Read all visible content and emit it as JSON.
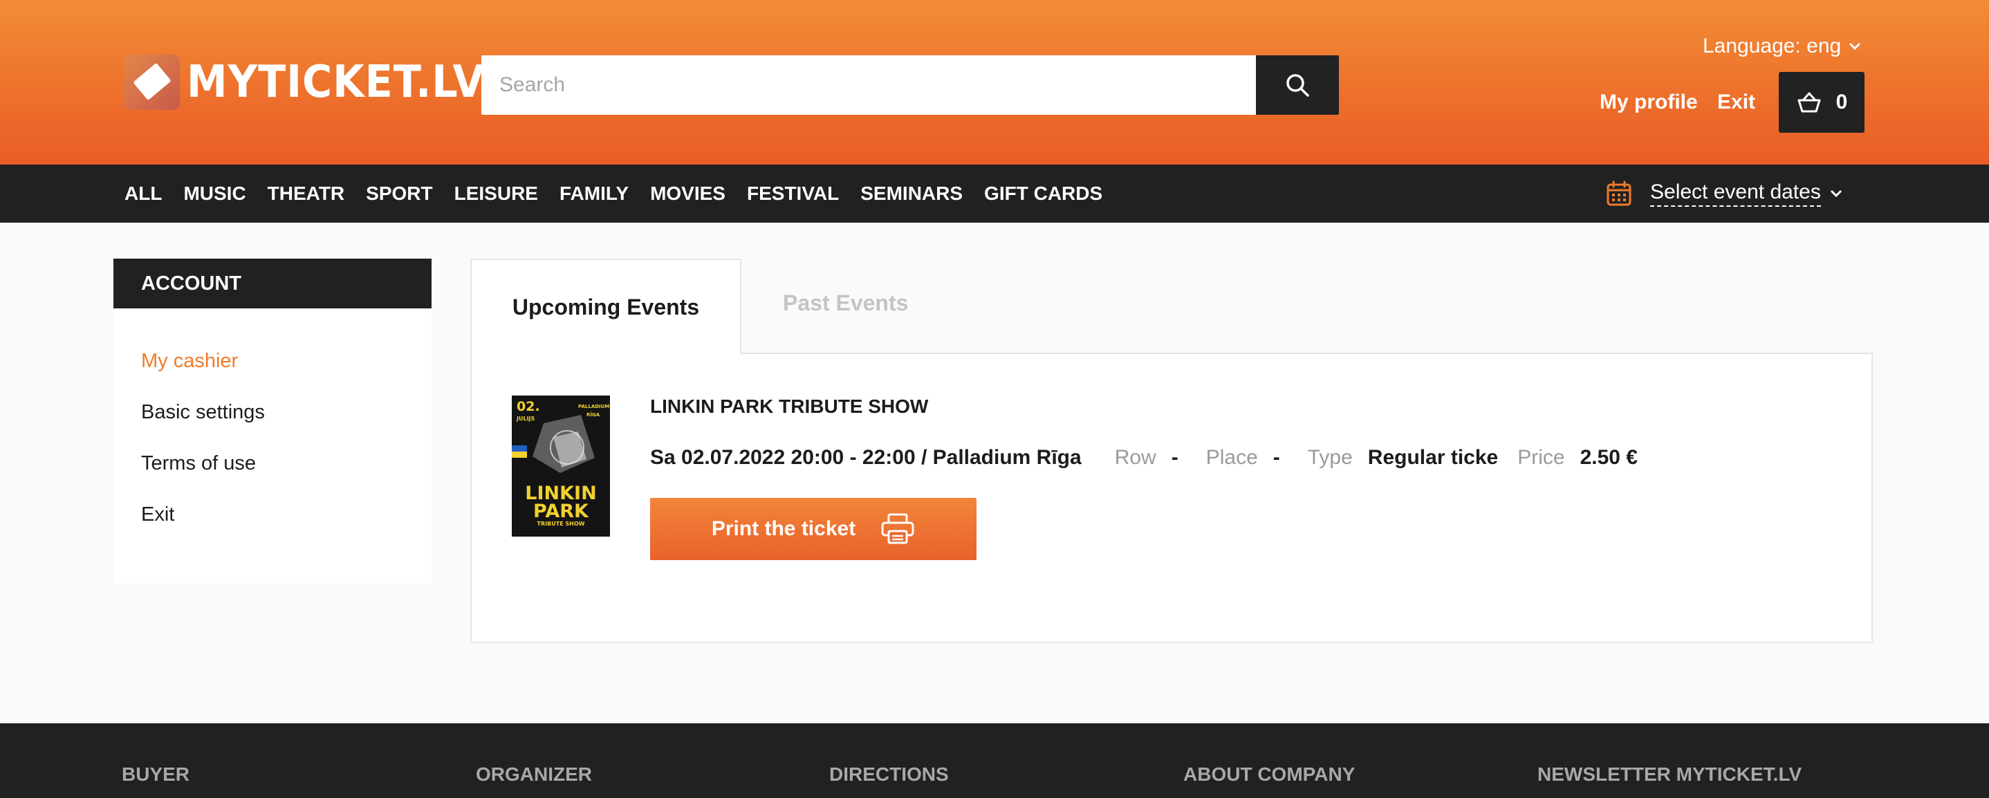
{
  "brand": {
    "name": "MYTICKET.LV"
  },
  "search": {
    "placeholder": "Search"
  },
  "header": {
    "language_label": "Language: eng",
    "profile_label": "My profile",
    "exit_label": "Exit",
    "cart_count": "0"
  },
  "nav": {
    "items": [
      "ALL",
      "MUSIC",
      "THEATR",
      "SPORT",
      "LEISURE",
      "FAMILY",
      "MOVIES",
      "FESTIVAL",
      "SEMINARS",
      "GIFT CARDS"
    ],
    "dates_label": "Select event dates"
  },
  "sidebar": {
    "title": "ACCOUNT",
    "items": [
      {
        "label": "My cashier",
        "active": true
      },
      {
        "label": "Basic settings",
        "active": false
      },
      {
        "label": "Terms of use",
        "active": false
      },
      {
        "label": "Exit",
        "active": false
      }
    ]
  },
  "tabs": [
    {
      "label": "Upcoming Events",
      "active": true
    },
    {
      "label": "Past Events",
      "active": false
    }
  ],
  "event": {
    "title": "LINKIN PARK TRIBUTE SHOW",
    "datetime_venue": "Sa 02.07.2022 20:00 - 22:00 / Palladium Rīga",
    "row_label": "Row",
    "row_value": "-",
    "place_label": "Place",
    "place_value": "-",
    "type_label": "Type",
    "type_value": "Regular ticke",
    "price_label": "Price",
    "price_value": "2.50 €",
    "print_label": "Print the ticket",
    "poster": {
      "date_text": "02.",
      "month_text": "JULIJS",
      "venue_text": "PALLADIUM",
      "city_text": "RĪGA",
      "band_line1": "LINKIN",
      "band_line2": "PARK",
      "subtitle": "TRIBUTE SHOW"
    }
  },
  "footer": {
    "columns": [
      "BUYER",
      "ORGANIZER",
      "DIRECTIONS",
      "ABOUT COMPANY",
      "NEWSLETTER MYTICKET.LV"
    ]
  },
  "colors": {
    "accent": "#ef7b2a",
    "dark": "#212121",
    "header_top": "#f28c36",
    "header_bottom": "#e85e27"
  },
  "icons": {
    "search": "search-icon",
    "cart": "cart-icon",
    "calendar": "calendar-icon",
    "printer": "printer-icon",
    "chevron": "chevron-down-icon"
  }
}
